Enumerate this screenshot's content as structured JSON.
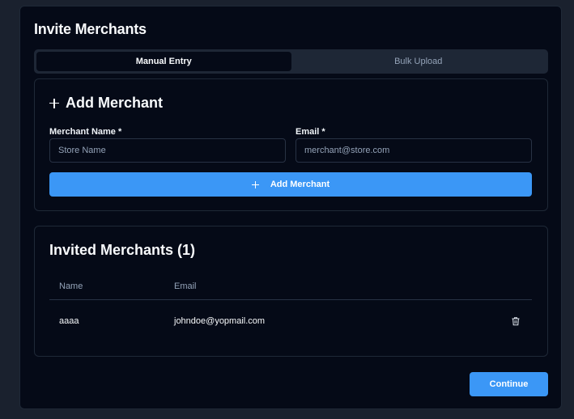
{
  "page": {
    "title": "Invite Merchants"
  },
  "tabs": [
    {
      "label": "Manual Entry",
      "active": true
    },
    {
      "label": "Bulk Upload",
      "active": false
    }
  ],
  "add_form": {
    "heading": "Add Merchant",
    "heading_icon": "plus-icon",
    "name_label": "Merchant Name *",
    "name_placeholder": "Store Name",
    "name_value": "",
    "email_label": "Email *",
    "email_placeholder": "merchant@store.com",
    "email_value": "",
    "button_label": "Add Merchant",
    "button_icon": "plus-icon"
  },
  "invited": {
    "heading": "Invited Merchants (1)",
    "columns": [
      "Name",
      "Email"
    ],
    "rows": [
      {
        "name": "aaaa",
        "email": "johndoe@yopmail.com",
        "action_icon": "trash-icon"
      }
    ]
  },
  "footer": {
    "continue_label": "Continue"
  },
  "colors": {
    "background": "#050a17",
    "accent": "#3b97f6",
    "border": "#1f2937"
  }
}
